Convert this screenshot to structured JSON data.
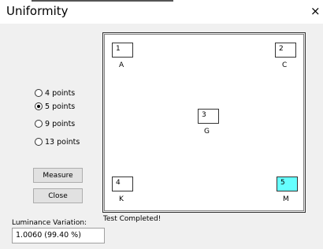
{
  "window": {
    "title": "Uniformity",
    "close_glyph": "×"
  },
  "options": [
    {
      "label": "4 points",
      "checked": false
    },
    {
      "label": "5 points",
      "checked": true
    },
    {
      "label": "9 points",
      "checked": false
    },
    {
      "label": "13 points",
      "checked": false
    }
  ],
  "buttons": {
    "measure": "Measure",
    "close": "Close"
  },
  "luminance": {
    "label": "Luminance Variation:",
    "value": "1.0060 (99.40 %)"
  },
  "points": [
    {
      "number": "1",
      "label": "A"
    },
    {
      "number": "2",
      "label": "C"
    },
    {
      "number": "3",
      "label": "G"
    },
    {
      "number": "4",
      "label": "K"
    },
    {
      "number": "5",
      "label": "M",
      "highlight": "#66ffff"
    }
  ],
  "status": "Test Completed!"
}
